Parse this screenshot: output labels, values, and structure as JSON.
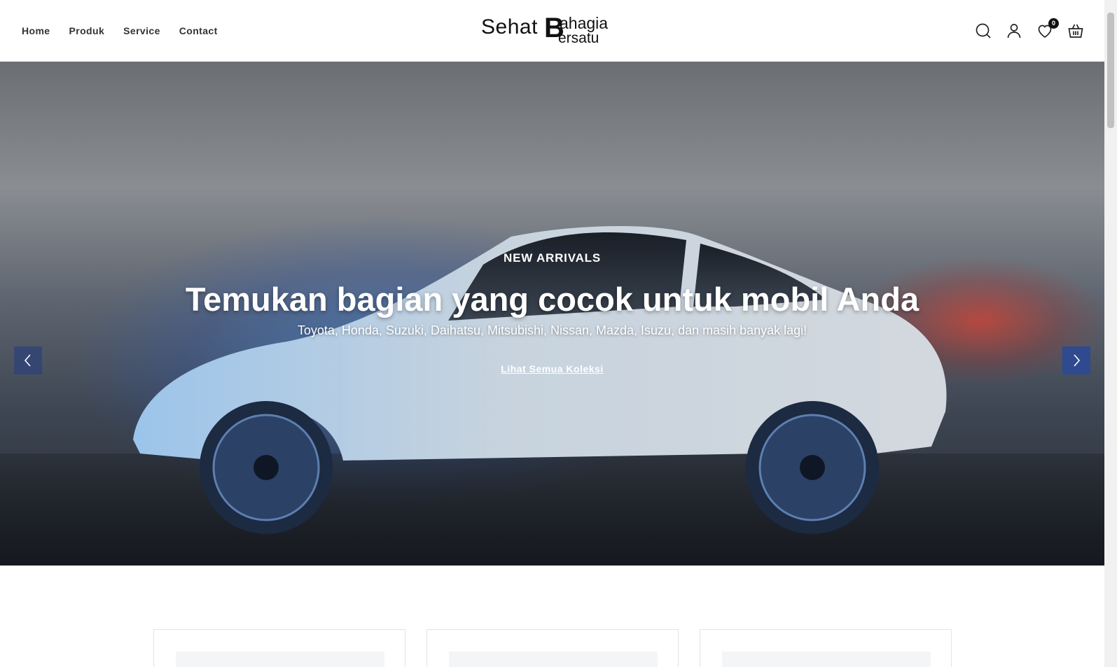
{
  "nav": {
    "items": [
      {
        "label": "Home"
      },
      {
        "label": "Produk"
      },
      {
        "label": "Service"
      },
      {
        "label": "Contact"
      }
    ]
  },
  "logo": {
    "part1": "Sehat",
    "part2_initial": "B",
    "part2a": "ahagia",
    "part2b": "ersatu"
  },
  "header_icons": {
    "search": "search-icon",
    "account": "user-icon",
    "wishlist": "heart-icon",
    "wishlist_count": "0",
    "cart": "basket-icon"
  },
  "hero": {
    "kicker": "NEW ARRIVALS",
    "headline": "Temukan bagian yang cocok untuk mobil Anda",
    "subline": "Toyota, Honda, Suzuki, Daihatsu, Mitsubishi, Nissan, Mazda, Isuzu, dan masih banyak lagi!",
    "cta": "Lihat Semua Koleksi",
    "slides_total": 3,
    "slide_active": 1
  },
  "colors": {
    "accent": "#2f4a8e",
    "text": "#333333"
  }
}
